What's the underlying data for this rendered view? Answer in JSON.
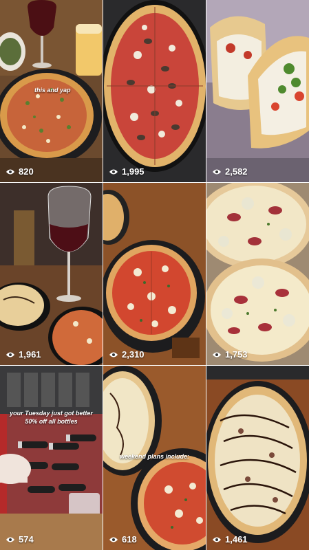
{
  "tiles": [
    {
      "views": "820",
      "caption": "this and yap"
    },
    {
      "views": "1,995"
    },
    {
      "views": "2,582"
    },
    {
      "views": "1,961"
    },
    {
      "views": "2,310"
    },
    {
      "views": "1,753"
    },
    {
      "views": "574",
      "caption_line1": "your Tuesday just got better",
      "caption_line2": "50% off all bottles"
    },
    {
      "views": "618",
      "caption": "weekend plans include:"
    },
    {
      "views": "1,461"
    }
  ],
  "icons": {
    "views": "eye-icon"
  }
}
